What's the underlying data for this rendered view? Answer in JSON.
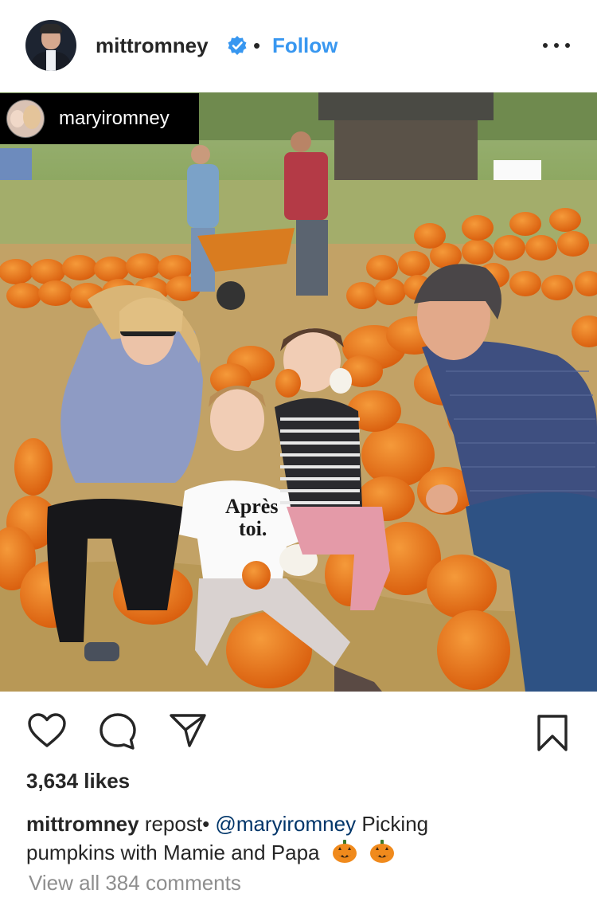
{
  "header": {
    "username": "mittromney",
    "separator": "•",
    "follow_label": "Follow"
  },
  "photo": {
    "tagged_user": "maryiromney",
    "shirt_text_line1": "Après",
    "shirt_text_line2": "toi."
  },
  "post": {
    "likes": "3,634 likes",
    "caption": {
      "username": "mittromney",
      "repost_text": "repost•",
      "mention": "@maryiromney",
      "text_line1": "Picking",
      "text_line2": "pumpkins with Mamie and Papa"
    },
    "view_comments": "View all 384 comments"
  },
  "icons": {
    "like": "heart-icon",
    "comment": "comment-bubble-icon",
    "share": "paper-plane-icon",
    "save": "bookmark-icon",
    "verified": "verified-badge-icon",
    "more": "more-dots-icon",
    "emoji": "jack-o-lantern-icon"
  },
  "colors": {
    "follow": "#3897f0",
    "mention": "#003569",
    "muted": "#8e8e8e",
    "text": "#262626"
  }
}
